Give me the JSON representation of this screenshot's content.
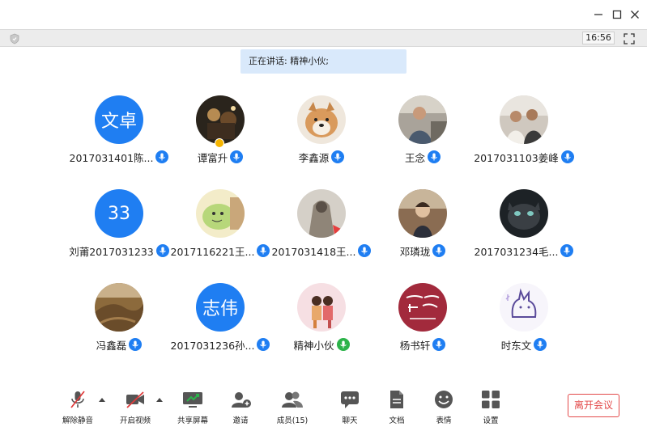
{
  "window": {
    "min_icon": "minimize-icon",
    "max_icon": "maximize-icon",
    "close_icon": "close-icon"
  },
  "infobar": {
    "time": "16:56"
  },
  "speaking": {
    "text": "正在讲话: 精神小伙;"
  },
  "participants": [
    {
      "name": "2017031401陈...",
      "avatar_text": "文卓",
      "mic": "on"
    },
    {
      "name": "谭富升",
      "avatar_text": "",
      "mic": "on",
      "host": true
    },
    {
      "name": "李鑫源",
      "avatar_text": "",
      "mic": "on"
    },
    {
      "name": "王念",
      "avatar_text": "",
      "mic": "on"
    },
    {
      "name": "2017031103姜峰",
      "avatar_text": "",
      "mic": "on"
    },
    {
      "name": "刘莆2017031233",
      "avatar_text": "33",
      "mic": "on"
    },
    {
      "name": "2017116221王...",
      "avatar_text": "",
      "mic": "on"
    },
    {
      "name": "2017031418王...",
      "avatar_text": "",
      "mic": "on"
    },
    {
      "name": "邓璘珑",
      "avatar_text": "",
      "mic": "on"
    },
    {
      "name": "2017031234毛...",
      "avatar_text": "",
      "mic": "on"
    },
    {
      "name": "冯鑫磊",
      "avatar_text": "",
      "mic": "on"
    },
    {
      "name": "2017031236孙...",
      "avatar_text": "志伟",
      "mic": "on"
    },
    {
      "name": "精神小伙",
      "avatar_text": "",
      "mic": "speaking"
    },
    {
      "name": "杨书轩",
      "avatar_text": "",
      "mic": "on"
    },
    {
      "name": "时东文",
      "avatar_text": "",
      "mic": "on"
    }
  ],
  "toolbar": {
    "unmute": "解除静音",
    "start_video": "开启视频",
    "share_screen": "共享屏幕",
    "invite": "邀请",
    "members": "成员(15)",
    "chat": "聊天",
    "docs": "文档",
    "reactions": "表情",
    "settings": "设置",
    "leave": "离开会议"
  },
  "colors": {
    "accent": "#1f7ef2",
    "mic_speaking": "#2cb34a",
    "leave": "#e34b4b"
  }
}
